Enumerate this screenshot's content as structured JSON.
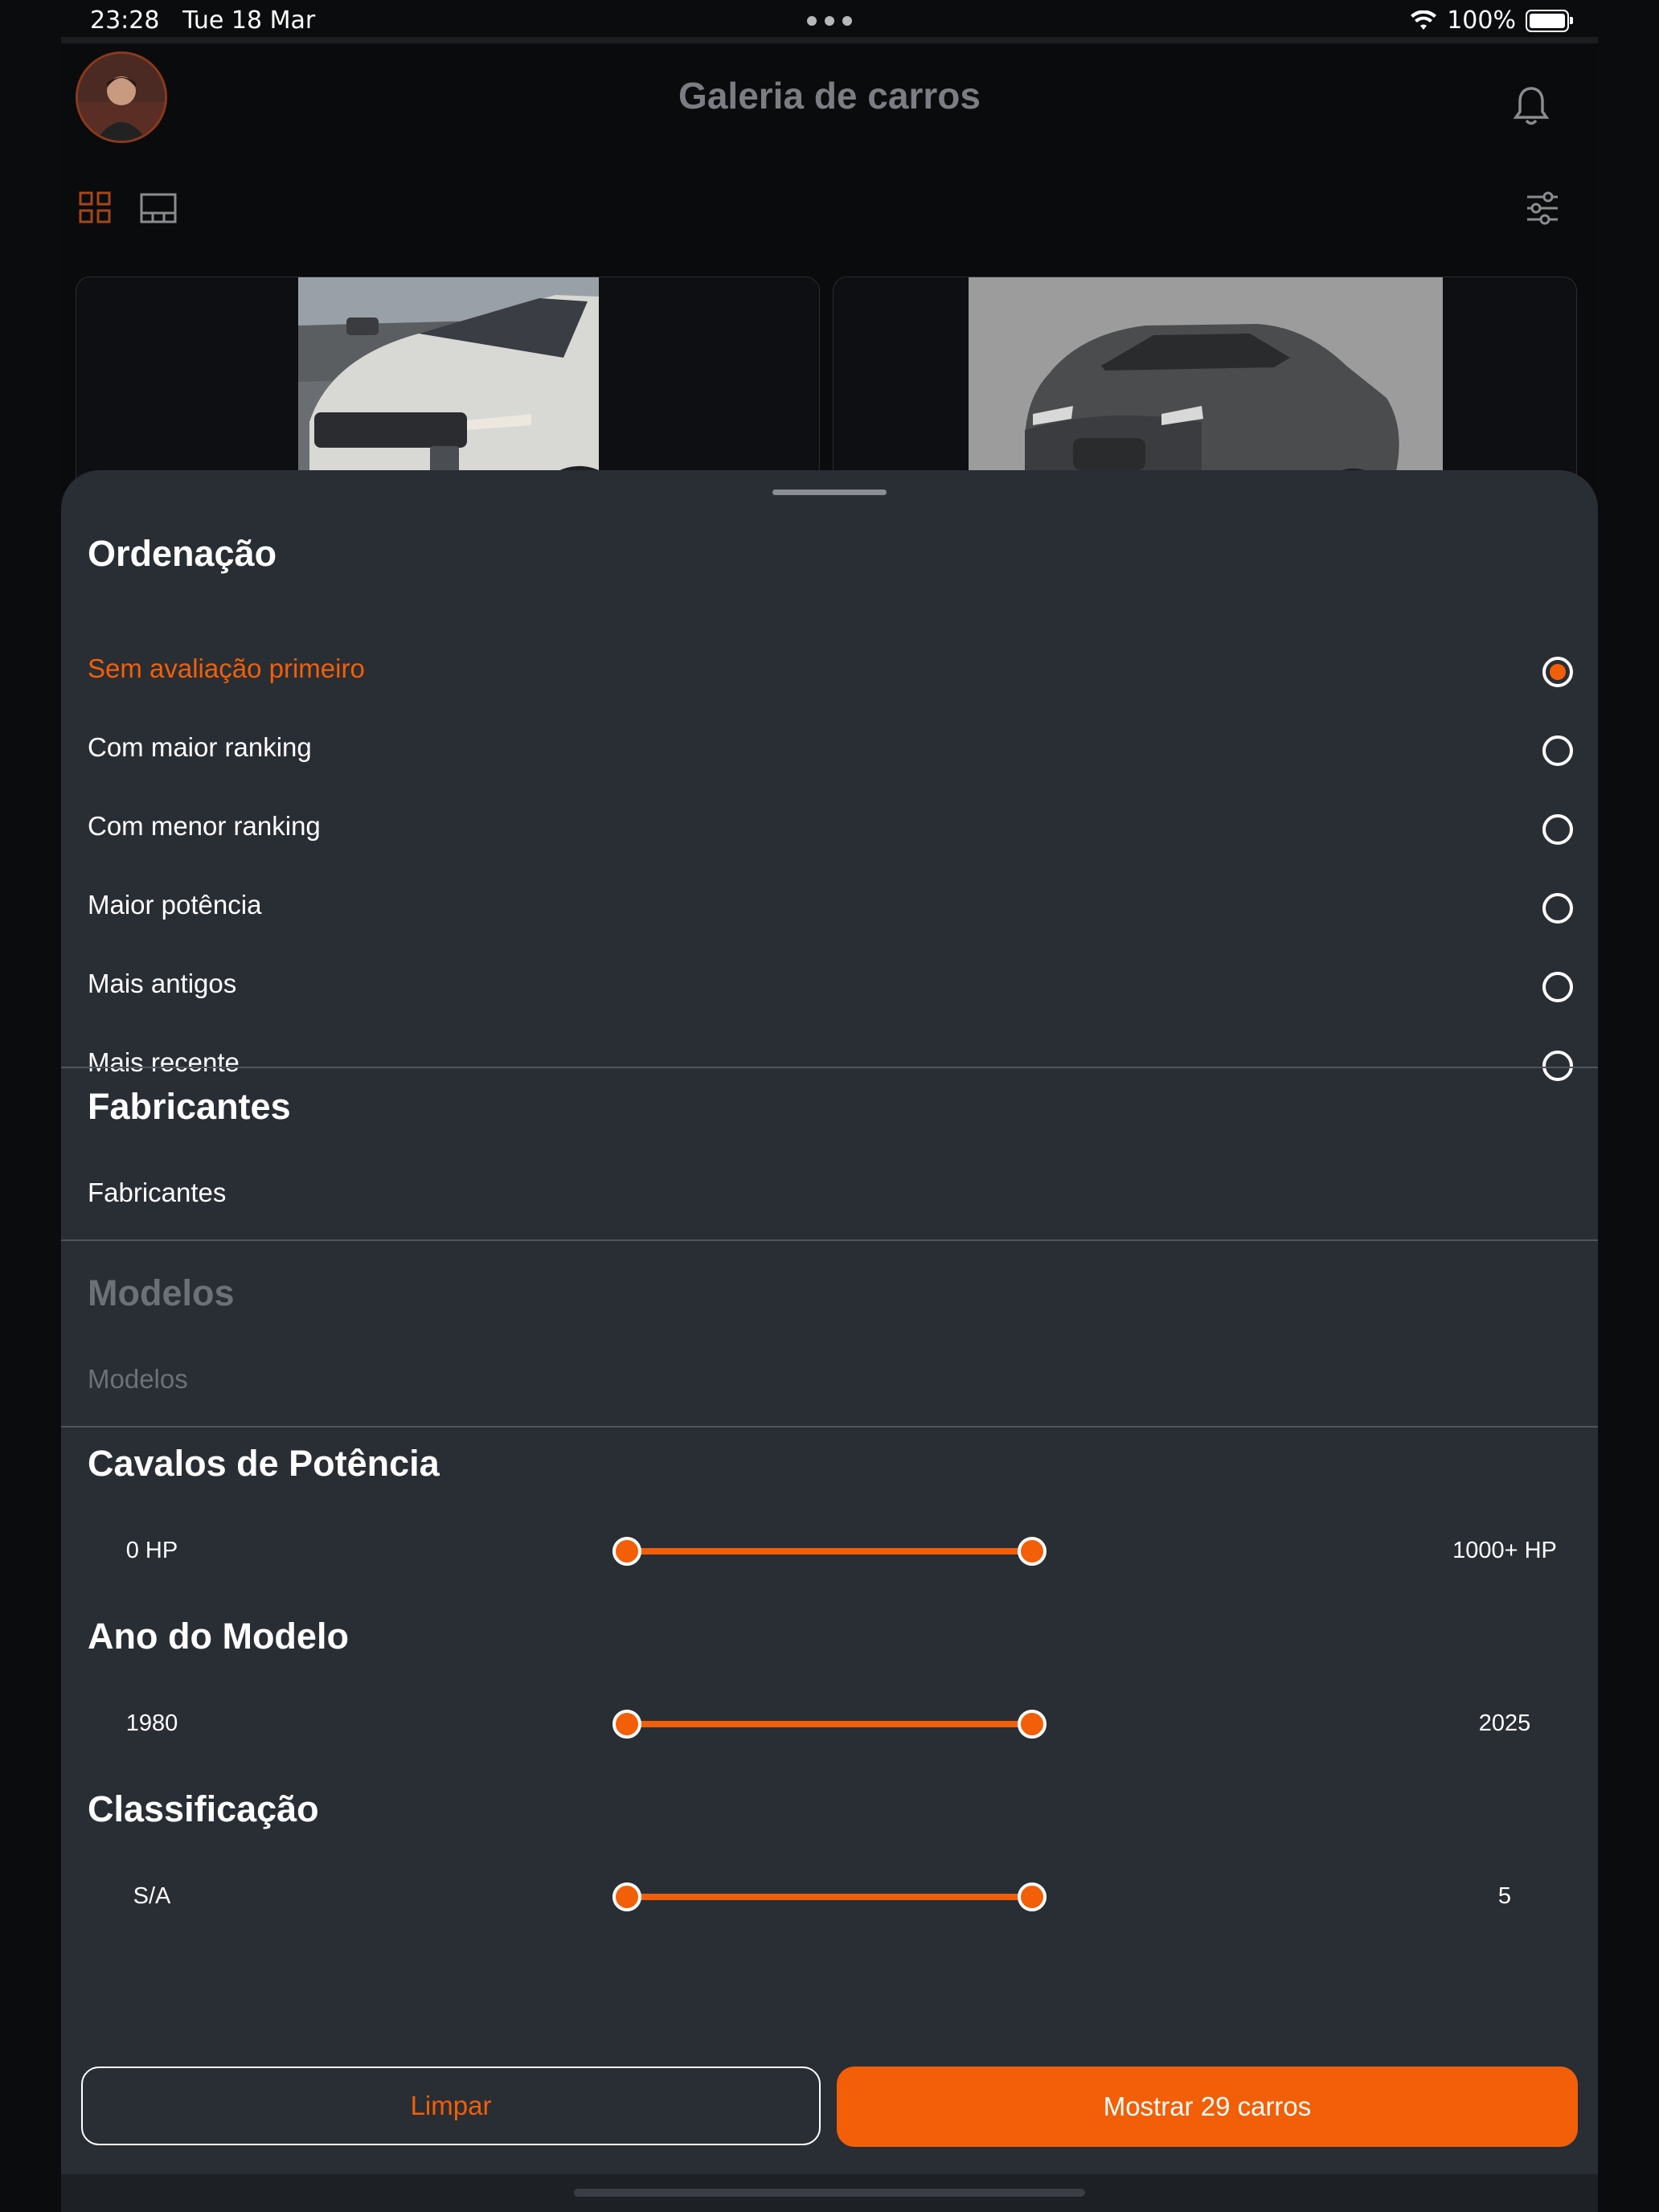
{
  "status_bar": {
    "time": "23:28",
    "date": "Tue 18 Mar",
    "battery": "100%"
  },
  "header": {
    "title": "Galeria de carros"
  },
  "icons": {
    "bell": "bell-icon",
    "grid_view": "grid-view-icon",
    "list_view": "gallery-view-icon",
    "filters": "sliders-icon"
  },
  "sheet": {
    "sort": {
      "title": "Ordenação",
      "options": [
        {
          "label": "Sem avaliação primeiro",
          "selected": true
        },
        {
          "label": "Com maior ranking",
          "selected": false
        },
        {
          "label": "Com menor ranking",
          "selected": false
        },
        {
          "label": "Maior potência",
          "selected": false
        },
        {
          "label": "Mais antigos",
          "selected": false
        },
        {
          "label": "Mais recente",
          "selected": false
        }
      ]
    },
    "manufacturers": {
      "title": "Fabricantes",
      "placeholder": "Fabricantes"
    },
    "models": {
      "title": "Modelos",
      "placeholder": "Modelos",
      "disabled": true
    },
    "horsepower": {
      "title": "Cavalos de Potência",
      "min_label": "0 HP",
      "max_label": "1000+ HP",
      "selected_min_fraction": 0,
      "selected_max_fraction": 1
    },
    "model_year": {
      "title": "Ano do Modelo",
      "min_label": "1980",
      "max_label": "2025",
      "selected_min_fraction": 0,
      "selected_max_fraction": 1
    },
    "rating": {
      "title": "Classificação",
      "min_label": "S/A",
      "max_label": "5",
      "selected_min_fraction": 0,
      "selected_max_fraction": 1
    },
    "buttons": {
      "clear": "Limpar",
      "show": "Mostrar 29 carros"
    }
  },
  "colors": {
    "accent": "#f25f08",
    "sheet_bg": "#292e35",
    "app_bg": "#0a0b0d"
  }
}
